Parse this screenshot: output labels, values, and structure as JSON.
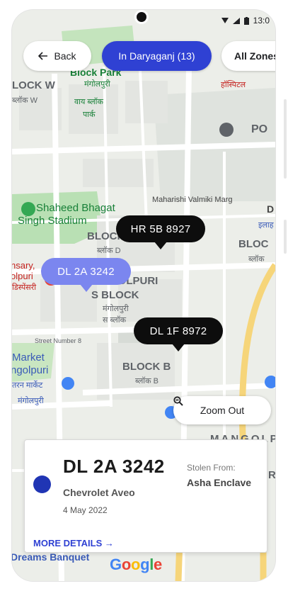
{
  "status": {
    "time": "13:0"
  },
  "nav": {
    "back_label": "Back",
    "area_label": "In Daryaganj (13)",
    "zones_label": "All Zones"
  },
  "map": {
    "labels": {
      "block_park": "Block Park",
      "gh": "g",
      "mangolpuri_hi": "मंगोलपुरी",
      "block_w": "LOCK W",
      "block_w_hi": "ब्लॉक W",
      "vay_block": "वाय ब्लॉक",
      "park_hi": "पार्क",
      "hospital_hi": "हॉस्पिटल",
      "pocket": "PO",
      "maharishi": "Maharishi Valmiki Marg",
      "shaheed": "Shaheed Bhagat",
      "singh": "Singh Stadium",
      "block_d": "BLOCK",
      "block_d_hi": "ब्लॉक D",
      "block_right": "BLOC",
      "block_right_hi": "ब्लॉक",
      "dispensary": "nsary,",
      "olpuri": "olpuri",
      "dispensary_hi": "डिस्पेंसरी",
      "golpuri": "GOLPURI",
      "s_block": "S BLOCK",
      "mangolpuri2_hi": "मंगोलपुरी",
      "s_block_hi": "स ब्लॉक",
      "street8": "Street Number 8",
      "market": "Market",
      "ngolpuri": "ngolpuri",
      "market_hi": "तरन मार्केट",
      "mangolpuri3_hi": "मंगोलपुरी",
      "block_b": "BLOCK B",
      "block_b_hi": "ब्लॉक B",
      "mangolpuri_en": "MANGOLP",
      "dreams": "Dreams Banquet",
      "illa": "इलाह",
      "d_letter": "D",
      "r_letter": "R"
    },
    "markers": [
      {
        "label": "HR 5B 8927",
        "color": "#0d0d0d"
      },
      {
        "label": "DL 2A 3242",
        "color": "#7b86ef"
      },
      {
        "label": "DL 1F 8972",
        "color": "#0d0d0d"
      }
    ],
    "zoom_label": "Zoom Out",
    "google_letters": [
      "G",
      "o",
      "o",
      "g",
      "l",
      "e"
    ]
  },
  "details": {
    "plate": "DL 2A 3242",
    "model": "Chevrolet Aveo",
    "date": "4 May 2022",
    "stolen_from_label": "Stolen From:",
    "stolen_from_value": "Asha Enclave",
    "more_label": "MORE DETAILS →",
    "dot_color": "#2035b4"
  },
  "colors": {
    "accent": "#2f41d3",
    "map_bg": "#e8ece8",
    "park": "#b7e2b3",
    "road_yellow": "#f6d57a"
  }
}
